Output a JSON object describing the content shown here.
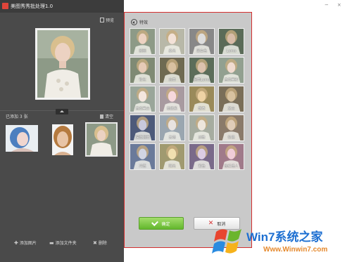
{
  "app": {
    "title": "美图秀秀批处理1.0",
    "preview_label": "预览",
    "added_count": "已添加 3 张",
    "clear_label": "清空"
  },
  "bottom_bar": [
    {
      "icon": "plus-icon",
      "glyph": "✚",
      "label": "添加图片"
    },
    {
      "icon": "folder-icon",
      "glyph": "▬",
      "label": "添加文件夹"
    },
    {
      "icon": "delete-icon",
      "glyph": "✖",
      "label": "删除"
    }
  ],
  "window_controls": {
    "minimize": "−",
    "close": "×"
  },
  "dialog": {
    "header": "特效",
    "effects": [
      "原图",
      "柔光",
      "黑白色",
      "Lomo",
      "铁化",
      "古典",
      "经典Lomo",
      "自然美肤",
      "自然美白",
      "粉嫩系",
      "暖黄",
      "复古",
      "深蓝泪雨",
      "云端",
      "淡雅",
      "优格",
      "冷蓝",
      "阳光",
      "紫色",
      "粉红佳人"
    ],
    "ok_label": "确定",
    "cancel_label": "取消"
  },
  "watermark": {
    "title": "Win7系统之家",
    "url": "Www.Winwin7.com"
  },
  "colors": {
    "left_panel": "#4a4a4a",
    "dialog_bg": "#c9c9c9",
    "dialog_border": "#d42f2f",
    "ok_green": "#63b72d",
    "watermark_blue": "#1d6fd1",
    "watermark_orange": "#e5892d"
  }
}
